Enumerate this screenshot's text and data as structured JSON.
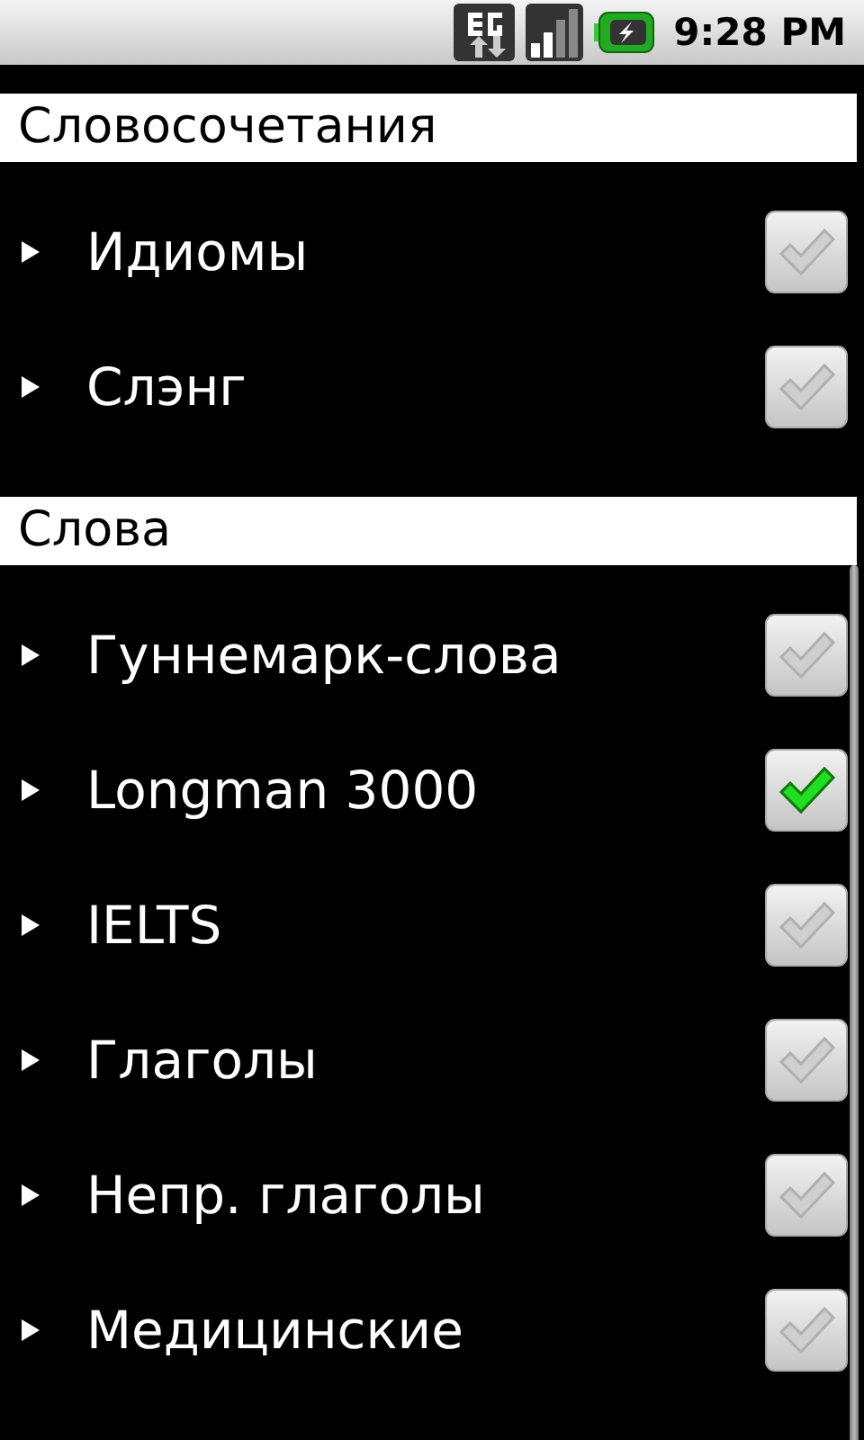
{
  "status_bar": {
    "time": "9:28 PM"
  },
  "sections": [
    {
      "title": "Словосочетания",
      "items": [
        {
          "label": "Идиомы",
          "checked": false
        },
        {
          "label": "Слэнг",
          "checked": false
        }
      ]
    },
    {
      "title": "Слова",
      "items": [
        {
          "label": "Гуннемарк-слова",
          "checked": false
        },
        {
          "label": "Longman 3000",
          "checked": true
        },
        {
          "label": "IELTS",
          "checked": false
        },
        {
          "label": "Глаголы",
          "checked": false
        },
        {
          "label": "Непр. глаголы",
          "checked": false
        },
        {
          "label": "Медицинские",
          "checked": false
        }
      ]
    }
  ]
}
